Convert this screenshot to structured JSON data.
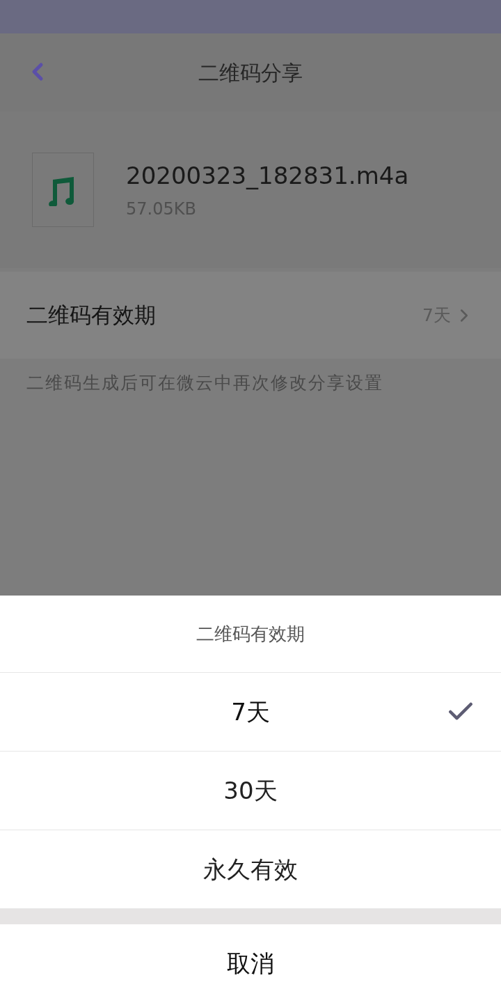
{
  "header": {
    "title": "二维码分享"
  },
  "file": {
    "name": "20200323_182831.m4a",
    "size": "57.05KB"
  },
  "setting": {
    "label": "二维码有效期",
    "value": "7天"
  },
  "note": "二维码生成后可在微云中再次修改分享设置",
  "sheet": {
    "title": "二维码有效期",
    "options": [
      {
        "label": "7天",
        "selected": true
      },
      {
        "label": "30天",
        "selected": false
      },
      {
        "label": "永久有效",
        "selected": false
      }
    ],
    "cancel": "取消"
  }
}
